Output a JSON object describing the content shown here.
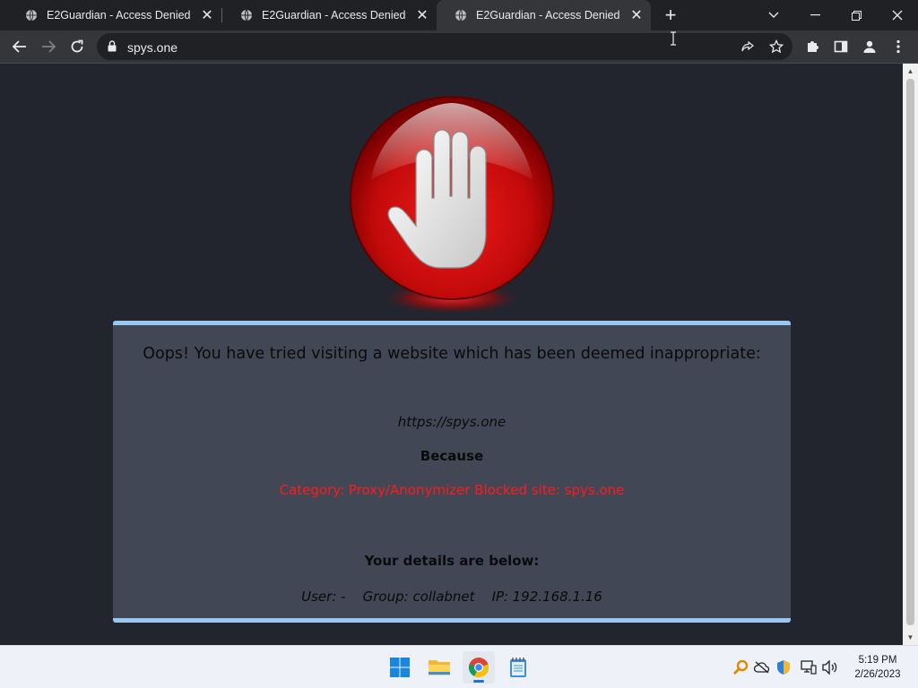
{
  "browser": {
    "tabs": [
      {
        "title": "E2Guardian - Access Denied",
        "active": false
      },
      {
        "title": "E2Guardian - Access Denied",
        "active": false
      },
      {
        "title": "E2Guardian - Access Denied",
        "active": true
      }
    ],
    "address": "spys.one",
    "icons": {
      "back": "back-arrow-icon",
      "forward": "forward-arrow-icon",
      "reload": "reload-icon",
      "lock": "lock-icon",
      "share": "share-icon",
      "bookmark": "star-icon",
      "extensions": "puzzle-icon",
      "sidepanel": "side-panel-icon",
      "profile": "profile-icon",
      "menu": "kebab-menu-icon"
    }
  },
  "page": {
    "headline": "Oops! You have tried visiting a website which has been deemed inappropriate:",
    "blocked_url": "https://spys.one",
    "because_label": "Because",
    "reason": "Category: Proxy/Anonymizer   Blocked site: spys.one",
    "details_title": "Your details are below:",
    "details": "User: -    Group: collabnet    IP: 192.168.1.16",
    "colors": {
      "panel_bg": "#424756",
      "panel_border": "#99c7f0",
      "reason_text": "#ff1a1a",
      "page_bg": "#22252e"
    }
  },
  "taskbar": {
    "apps": [
      "windows-start-icon",
      "file-explorer-icon",
      "chrome-icon",
      "notepad-icon"
    ],
    "tray": [
      "search-magnifier-icon",
      "cloud-offline-icon",
      "security-shield-icon",
      "network-icon",
      "volume-icon"
    ],
    "time": "5:19 PM",
    "date": "2/26/2023"
  }
}
